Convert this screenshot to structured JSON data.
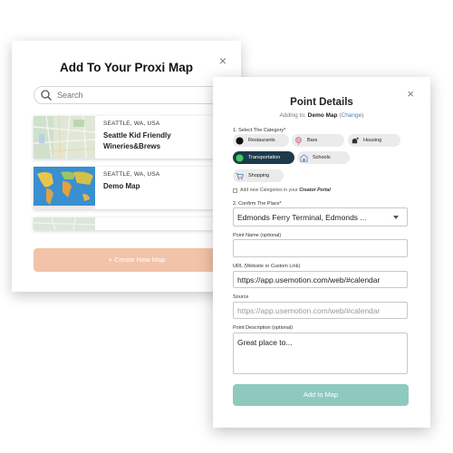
{
  "back_modal": {
    "title": "Add To Your Proxi Map",
    "close": "×",
    "search_placeholder": "Search",
    "maps": [
      {
        "location": "SEATTLE, WA, USA",
        "name_line1": "Seattle Kid Friendly",
        "name_line2": "Wineries&Brews"
      },
      {
        "location": "SEATTLE, WA, USA",
        "name_line1": "Demo Map",
        "name_line2": ""
      }
    ],
    "create_button": "+ Create New Map"
  },
  "front_modal": {
    "title": "Point Details",
    "close": "×",
    "adding_prefix": "Adding to:",
    "adding_map": "Demo Map",
    "change_open": "(",
    "change_link": "Change",
    "change_close": ")",
    "category_label": "1. Select The Category*",
    "categories": [
      {
        "label": "Restaurants",
        "icon": "restaurant-dot-icon",
        "active": false
      },
      {
        "label": "Bars",
        "icon": "balloon-icon",
        "active": false
      },
      {
        "label": "Housing",
        "icon": "housing-icon",
        "active": false
      },
      {
        "label": "Transportation",
        "icon": "transport-dot-icon",
        "active": true
      },
      {
        "label": "Schools",
        "icon": "school-icon",
        "active": false
      },
      {
        "label": "Shopping",
        "icon": "cart-icon",
        "active": false
      }
    ],
    "add_categories_text": "Add new Categories in your",
    "creator_portal": "Creator Portal",
    "place_label": "2. Confirm The Place*",
    "place_value": "Edmonds Ferry Terminal, Edmonds ...",
    "point_name_label": "Point Name (optional)",
    "point_name_value": "",
    "url_label": "URL (Website or Custom Link)",
    "url_value": "https://app.usemotion.com/web/#calendar",
    "source_label": "Source",
    "source_placeholder": "https://app.usemotion.com/web/#calendar",
    "description_label": "Point Description (optional)",
    "description_value": "Great place to...",
    "add_button": "Add to Map"
  },
  "colors": {
    "active_chip": "#1d3a4c",
    "create_button": "#f2c3a9",
    "add_button": "#8ec9bf",
    "link": "#4a7fb8"
  }
}
